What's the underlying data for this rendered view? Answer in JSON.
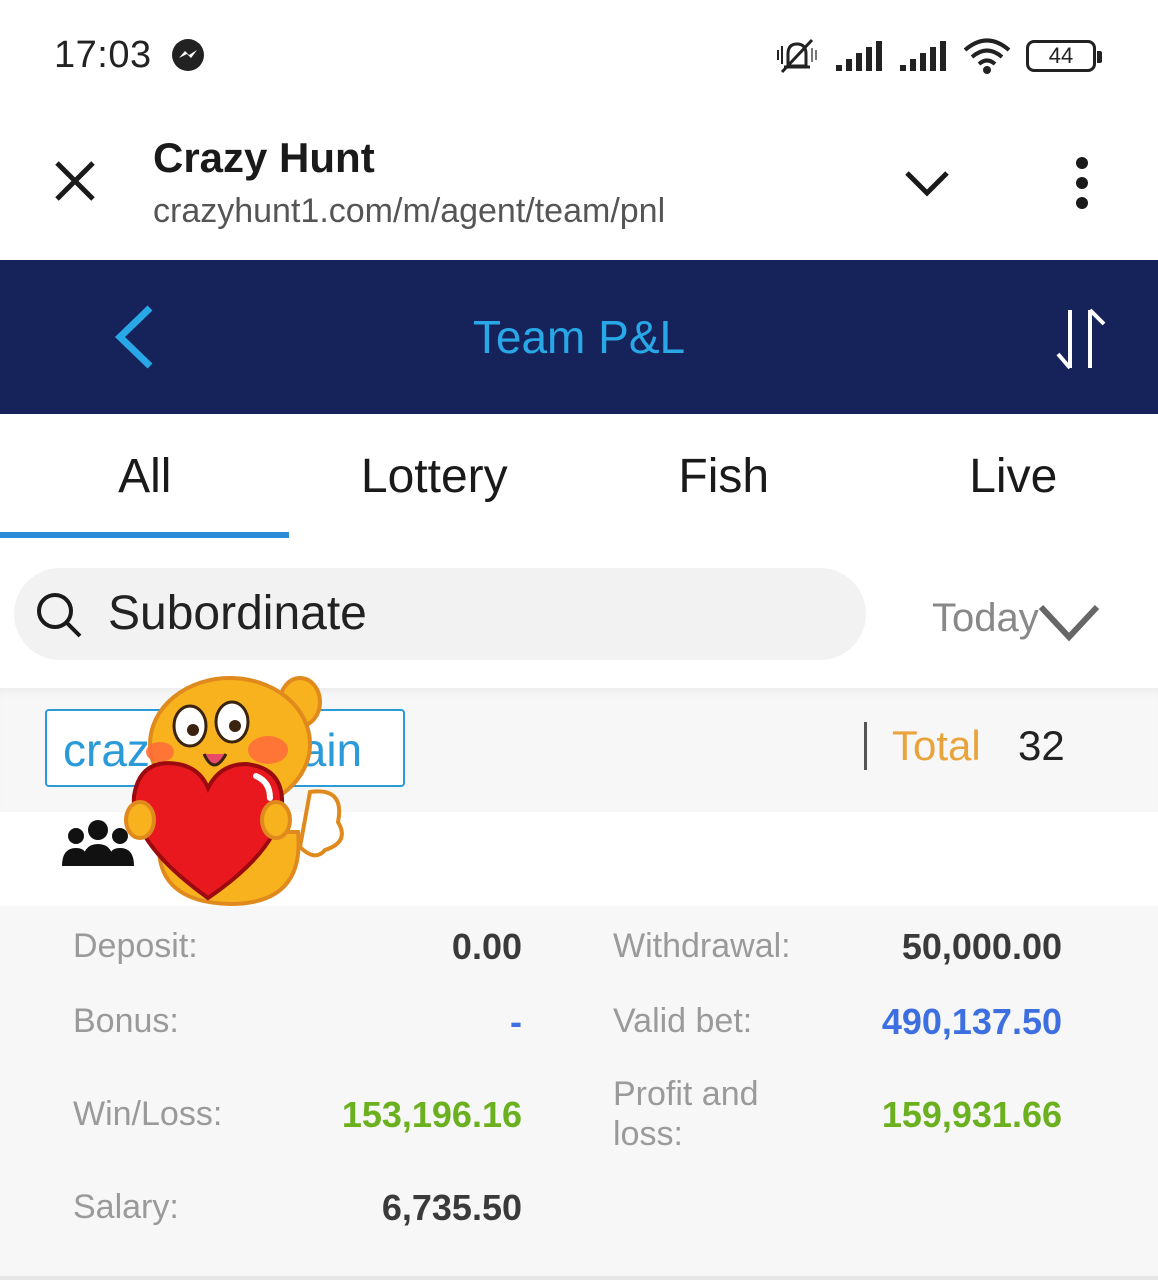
{
  "status_bar": {
    "time": "17:03",
    "battery": "44",
    "icons": [
      "messenger-icon",
      "mute-icon",
      "signal-icon",
      "signal-icon",
      "wifi-icon",
      "battery-icon"
    ]
  },
  "browser": {
    "title": "Crazy Hunt",
    "url": "crazyhunt1.com/m/agent/team/pnl"
  },
  "app_nav": {
    "title": "Team P&L"
  },
  "tabs": [
    {
      "label": "All",
      "active": true
    },
    {
      "label": "Lottery",
      "active": false
    },
    {
      "label": "Fish",
      "active": false
    },
    {
      "label": "Live",
      "active": false
    }
  ],
  "search": {
    "label": "Subordinate"
  },
  "date_filter": {
    "label": "Today"
  },
  "member": {
    "tag_text": "crazyhuntmain",
    "total_label": "Total",
    "total_value": "32"
  },
  "stats": {
    "deposit": {
      "label": "Deposit:",
      "value": "0.00"
    },
    "withdrawal": {
      "label": "Withdrawal:",
      "value": "50,000.00"
    },
    "bonus": {
      "label": "Bonus:",
      "value": "-"
    },
    "valid_bet": {
      "label": "Valid bet:",
      "value": "490,137.50"
    },
    "win_loss": {
      "label": "Win/Loss:",
      "value": "153,196.16"
    },
    "profit_loss": {
      "label_line1": "Profit and",
      "label_line2": "loss:",
      "value": "159,931.66"
    },
    "salary": {
      "label": "Salary:",
      "value": "6,735.50"
    }
  },
  "colors": {
    "nav_bg": "#16235a",
    "accent_blue": "#29a8e8",
    "total_orange": "#e8a33a",
    "value_blue": "#3d6fe0",
    "value_green": "#6ab01f"
  }
}
